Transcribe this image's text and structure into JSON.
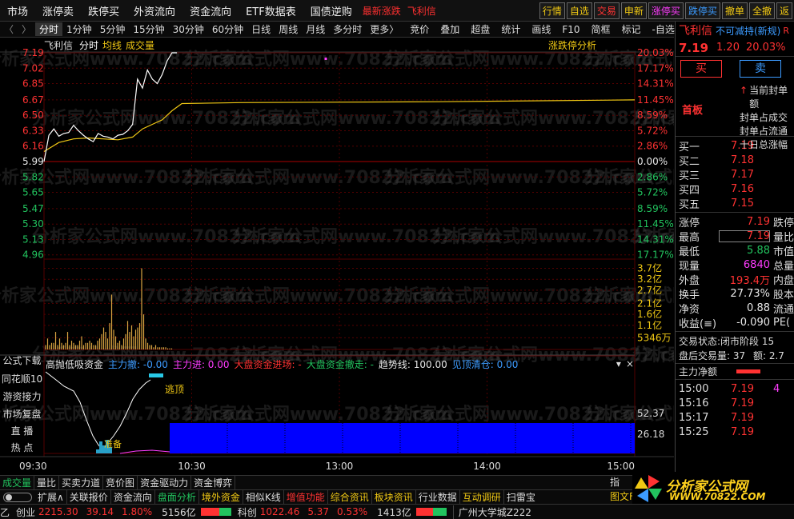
{
  "menu": {
    "items": [
      "市场",
      "涨停卖",
      "跌停买",
      "外资流向",
      "资金流向",
      "ETF数据表",
      "国债逆购"
    ],
    "alerts": [
      "最新涨跌",
      "飞利信"
    ],
    "quick": [
      {
        "label": "行情",
        "color": "#f0c814"
      },
      {
        "label": "自选",
        "color": "#f0c814"
      },
      {
        "label": "交易",
        "color": "#ff3232"
      },
      {
        "label": "申新",
        "color": "#f0c814"
      },
      {
        "label": "涨停买",
        "color": "#ff3cff"
      },
      {
        "label": "跌停买",
        "color": "#3c9bff"
      },
      {
        "label": "撤单",
        "color": "#f0c814"
      },
      {
        "label": "全撤",
        "color": "#f0c814"
      },
      {
        "label": "返",
        "color": "#f0c814"
      }
    ]
  },
  "toolbar": {
    "periods": [
      "分时",
      "1分钟",
      "5分钟",
      "15分钟",
      "30分钟",
      "60分钟",
      "日线",
      "周线",
      "月线",
      "多分时",
      "更多"
    ],
    "more_arrow": "〉",
    "tools": [
      "竞价",
      "叠加",
      "超盘",
      "统计",
      "画线",
      "F10",
      "简框",
      "标记",
      "-自选",
      "返回"
    ],
    "scroll_arrows": [
      "〈",
      "〉"
    ]
  },
  "chart_header": {
    "stock": "飞利信",
    "mode": "分时",
    "avg_label": "均线",
    "vol_label": "成交量",
    "analysis": "涨跌停分析"
  },
  "colors": {
    "up": "#ff3232",
    "down": "#22c35e",
    "flat": "#e8e8e8",
    "price_line": "#ffffff",
    "avg_line": "#f0c814",
    "volume": "#d9a441",
    "indicator_fill": "#0000ff",
    "grid": "#550000"
  },
  "chart_data": [
    {
      "type": "line",
      "title": "",
      "x_ticks": [
        "09:30",
        "10:30",
        "13:00",
        "14:00",
        "15:00"
      ],
      "prev_close": 5.99,
      "ylim": [
        4.79,
        7.19
      ],
      "y_ticks_left": [
        "7.19",
        "7.02",
        "6.85",
        "6.67",
        "6.50",
        "6.33",
        "6.16",
        "5.99",
        "5.82",
        "5.65",
        "5.47",
        "5.30",
        "5.13",
        "4.96"
      ],
      "y_ticks_right": [
        "20.03%",
        "17.17%",
        "14.31%",
        "11.45%",
        "8.59%",
        "5.72%",
        "2.86%",
        "0.00%",
        "2.86%",
        "5.72%",
        "8.59%",
        "11.45%",
        "14.31%",
        "17.17%"
      ],
      "series": [
        {
          "values_t": [
            0,
            2,
            4,
            6,
            8,
            10,
            12,
            14,
            16,
            18,
            20,
            22,
            24,
            26,
            28,
            30,
            32,
            34,
            36,
            38,
            40,
            42,
            44,
            46,
            48,
            50,
            52,
            54
          ],
          "values": [
            5.99,
            6.28,
            6.35,
            6.27,
            6.3,
            6.31,
            6.39,
            6.33,
            6.28,
            6.24,
            6.21,
            6.3,
            6.27,
            6.26,
            6.24,
            6.28,
            6.29,
            6.33,
            6.4,
            6.9,
            6.8,
            7.0,
            6.9,
            6.85,
            6.95,
            7.1,
            7.19,
            7.19
          ]
        },
        {
          "values_t": [
            0,
            6,
            12,
            18,
            24,
            30,
            36,
            40,
            44,
            48,
            52,
            56,
            80,
            160,
            240
          ],
          "values": [
            6.1,
            6.2,
            6.24,
            6.25,
            6.24,
            6.23,
            6.26,
            6.35,
            6.4,
            6.45,
            6.55,
            6.63,
            6.64,
            6.65,
            6.67
          ]
        }
      ]
    },
    {
      "type": "bar",
      "title": "",
      "y_ticks": [
        "3.7亿",
        "3.2亿",
        "2.7亿",
        "2.1亿",
        "1.6亿",
        "1.1亿",
        "5346万"
      ],
      "values": [
        0.2,
        0.5,
        0.2,
        0.3,
        0.3,
        0.8,
        0.2,
        0.5,
        0.3,
        0.2,
        0.3,
        0.8,
        0.2,
        0.4,
        0.3,
        0.2,
        0.2,
        0.4,
        0.6,
        0.2,
        0.3,
        0.3,
        0.4,
        0.3,
        0.2,
        0.2,
        0.4,
        0.5,
        0.7,
        1.0,
        0.8,
        0.5,
        1.2,
        2.5,
        0.9,
        0.6,
        0.3,
        0.4,
        0.2,
        0.5,
        0.7,
        1.3,
        0.8,
        1.1,
        0.6,
        0.9,
        1.0,
        1.2,
        3.7,
        1.6,
        0.5,
        0.3,
        0.2,
        0.2,
        0.1,
        0.2,
        0.1,
        0.1,
        0.1,
        0.1,
        0.1,
        0.05,
        0.05,
        0.05
      ]
    }
  ],
  "indicator": {
    "name": "高抛低吸资金",
    "items": [
      {
        "label": "主力撤:",
        "value": "-0.00",
        "color": "#3c9bff"
      },
      {
        "label": "主力进:",
        "value": "0.00",
        "color": "#ff3cff"
      },
      {
        "label": "大盘资金进场:",
        "value": "-",
        "color": "#ff3232"
      },
      {
        "label": "大盘资金撤走:",
        "value": "-",
        "color": "#22c35e"
      },
      {
        "label": "趋势线:",
        "value": "100.00",
        "color": "#e8e8e8"
      },
      {
        "label": "见顶清仓:",
        "value": "0.00",
        "color": "#3c9bff"
      }
    ],
    "y_ticks": [
      "52.37",
      "26.18"
    ],
    "signal_top": "逃顶",
    "signal_bottom": "准备",
    "controls": [
      "▾",
      "×"
    ]
  },
  "side_labels": [
    "公式下载",
    "同花顺10",
    "游资接力",
    "市场复盘",
    "直 播",
    "热 点"
  ],
  "right_panel": {
    "name": "飞利信",
    "note": "不可减持(新规)",
    "flag": "R",
    "price": "7.19",
    "change": "1.20",
    "pct": "20.03%",
    "buy_label": "买",
    "sell_label": "卖",
    "board_label": "首板",
    "board_info": [
      "当前封单额",
      "封单占成交",
      "封单占流通",
      "十日总涨幅"
    ],
    "bids": [
      {
        "label": "买一",
        "price": "7.19"
      },
      {
        "label": "买二",
        "price": "7.18"
      },
      {
        "label": "买三",
        "price": "7.17"
      },
      {
        "label": "买四",
        "price": "7.16"
      },
      {
        "label": "买五",
        "price": "7.15"
      }
    ],
    "stats": [
      {
        "label": "涨停",
        "value": "7.19",
        "color": "#ff3232",
        "label2": "跌停"
      },
      {
        "label": "最高",
        "value": "7.19",
        "color": "#ff3232",
        "label2": "量比"
      },
      {
        "label": "最低",
        "value": "5.88",
        "color": "#22c35e",
        "label2": "市值"
      },
      {
        "label": "现量",
        "value": "6840",
        "color": "#ff3cff",
        "label2": "总量"
      },
      {
        "label": "外盘",
        "value": "193.4万",
        "color": "#ff3232",
        "label2": "内盘"
      },
      {
        "label": "换手",
        "value": "27.73%",
        "color": "#e8e8e8",
        "label2": "股本"
      },
      {
        "label": "净资",
        "value": "0.88",
        "color": "#e8e8e8",
        "label2": "流通"
      },
      {
        "label": "收益(≡)",
        "value": "-0.090",
        "color": "#e8e8e8",
        "label2": "PE("
      }
    ],
    "trade_state_label": "交易状态:",
    "trade_state": "闭市阶段",
    "trade_state_suffix": "15",
    "after_hours_label": "盘后交易量:",
    "after_hours_vol": "37",
    "after_hours_amt_label": "额:",
    "after_hours_amt": "2.7",
    "net_flow_label": "主力净额",
    "ticks": [
      {
        "time": "15:00",
        "price": "7.19",
        "extra": "4"
      },
      {
        "time": "15:16",
        "price": "7.19",
        "extra": ""
      },
      {
        "time": "15:17",
        "price": "7.19",
        "extra": ""
      },
      {
        "time": "15:25",
        "price": "7.19",
        "extra": ""
      }
    ],
    "tab_icons": [
      "指",
      "图文F1"
    ]
  },
  "bottom_tabs": [
    "成交量",
    "量比",
    "买卖力道",
    "竞价图",
    "资金驱动力",
    "资金博弈"
  ],
  "bottom_tabs2": [
    "扩展∧",
    "关联报价",
    "资金流向",
    "盘面分析",
    "境外资金",
    "相似K线",
    "增值功能",
    "综合资讯",
    "板块资讯",
    "行业数据",
    "互动调研",
    "扫雷宝"
  ],
  "status": {
    "toggle_label": "",
    "items": [
      {
        "name": "创业",
        "value": "2215.30",
        "change": "39.14",
        "pct": "1.80%",
        "amount": "5156亿"
      },
      {
        "name": "科创",
        "value": "1022.46",
        "change": "5.37",
        "pct": "0.53%",
        "amount": "1413亿"
      }
    ],
    "prefix": "乙",
    "news": "广州大学城Z222"
  },
  "logo": {
    "text": "分析家公式网",
    "url": "WWW.70822.COM"
  },
  "watermark": "分析家公式网www.70822.com"
}
